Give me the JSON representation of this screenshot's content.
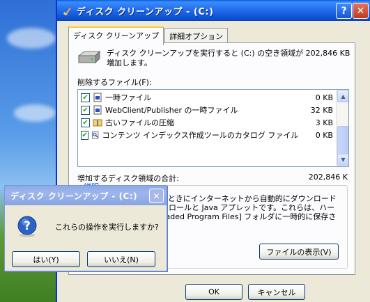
{
  "main_window": {
    "title": "ディスク クリーンアップ - (C:)",
    "help_glyph": "?",
    "close_glyph": "✕",
    "tabs": [
      "ディスク クリーンアップ",
      "詳細オプション"
    ],
    "intro_text": "ディスク クリーンアップを実行すると (C:) の空き領域が 202,846 KB 増加します。",
    "delete_label": "削除するファイル(F):",
    "files": [
      {
        "name": "一時ファイル",
        "size": "0 KB",
        "checked": true,
        "icon": "file-icon"
      },
      {
        "name": "WebClient/Publisher の一時ファイル",
        "size": "32 KB",
        "checked": true,
        "icon": "file-icon"
      },
      {
        "name": "古いファイルの圧縮",
        "size": "3 KB",
        "checked": true,
        "icon": "compress-icon"
      },
      {
        "name": "コンテンツ インデックス作成ツールのカタログ ファイル",
        "size": "0 KB",
        "checked": true,
        "icon": "search-file-icon"
      }
    ],
    "total_label": "増加するディスク領域の合計:",
    "total_value": "202,846 K",
    "description_legend": "説明",
    "description_text": "特定のページを表示したときにインターネットから自動的にダウンロードされる、ActiveX コントロールと Java アプレットです。これらは、ハード ディスクの [Downloaded Program Files] フォルダに一時的に保存されます。",
    "view_files_button": "ファイルの表示(V)",
    "ok_button": "OK",
    "cancel_button": "キャンセル"
  },
  "confirm_dialog": {
    "title": "ディスク クリーンアップ - (C:)",
    "close_glyph": "✕",
    "message": "これらの操作を実行しますか?",
    "yes_button": "はい(Y)",
    "no_button": "いいえ(N)"
  },
  "colors": {
    "titlebar_active": "#0b4fd1",
    "titlebar_inactive": "#9db6ec",
    "dialog_face": "#ece9d8",
    "legend_blue": "#0046d5"
  }
}
